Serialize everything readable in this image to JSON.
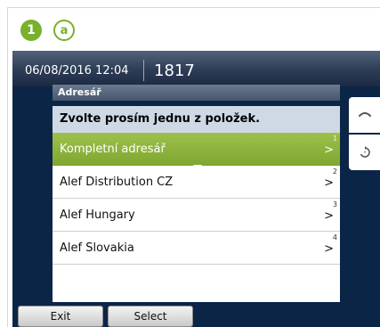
{
  "badges": {
    "step": "1",
    "letter": "a"
  },
  "status": {
    "datetime": "06/08/2016 12:04",
    "extension": "1817"
  },
  "dialog": {
    "title": "Adresář",
    "prompt": "Zvolte prosím jednu z položek.",
    "items": [
      {
        "label": "Kompletní adresář",
        "num": "1",
        "arrow": ">"
      },
      {
        "label": "Alef Distribution CZ",
        "num": "2",
        "arrow": ">"
      },
      {
        "label": "Alef Hungary",
        "num": "3",
        "arrow": ">"
      },
      {
        "label": "Alef Slovakia",
        "num": "4",
        "arrow": ">"
      }
    ],
    "selected_index": 0
  },
  "side_buttons": {
    "top_icon": "handset-icon",
    "bottom_icon": "redial-icon"
  },
  "softkeys": {
    "exit": "Exit",
    "select": "Select"
  },
  "colors": {
    "accent": "#79b02c",
    "selection": "#8cb33d",
    "screen_bg": "#0b2547"
  }
}
